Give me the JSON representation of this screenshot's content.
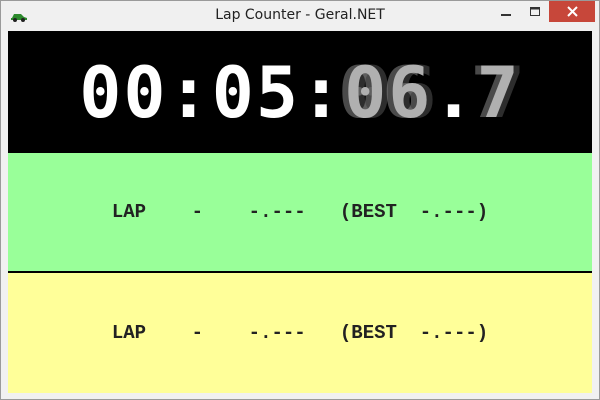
{
  "window": {
    "title": "Lap Counter - Geral.NET",
    "app_icon": "car-icon",
    "controls": {
      "minimize": "minimize-icon",
      "maximize": "maximize-icon",
      "close": "close-icon"
    }
  },
  "clock": {
    "hh": "00",
    "sep1": ":",
    "mm": "05",
    "sep2": ":",
    "ss": "06",
    "dot": ".",
    "tenths": "7"
  },
  "laps": [
    {
      "label": "LAP",
      "number": "-",
      "time": "-.---",
      "best_label": "(BEST",
      "best_time": "-.---)",
      "color": "#99ff99"
    },
    {
      "label": "LAP",
      "number": "-",
      "time": "-.---",
      "best_label": "(BEST",
      "best_time": "-.---)",
      "color": "#ffff99"
    }
  ],
  "colors": {
    "clock_bg": "#000000",
    "close_button": "#c7473a"
  }
}
